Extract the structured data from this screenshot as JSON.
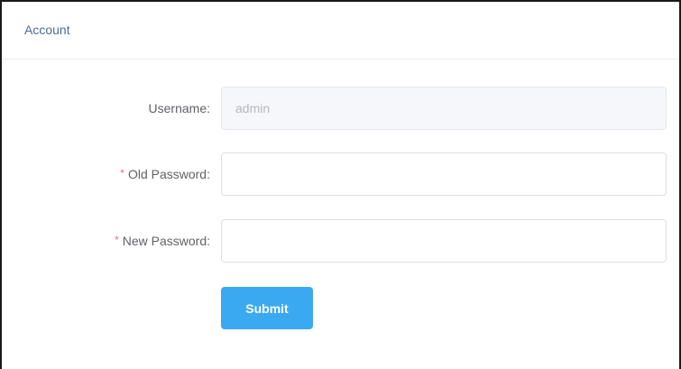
{
  "header": {
    "title": "Account"
  },
  "form": {
    "username": {
      "label": "Username:",
      "value": "admin",
      "required": false
    },
    "old_password": {
      "label": "Old Password:",
      "required_mark": "*",
      "value": ""
    },
    "new_password": {
      "label": "New Password:",
      "required_mark": "*",
      "value": ""
    },
    "submit_label": "Submit"
  },
  "colors": {
    "accent": "#3aa9f1",
    "required": "#f56c6c",
    "title": "#4a6f93"
  }
}
